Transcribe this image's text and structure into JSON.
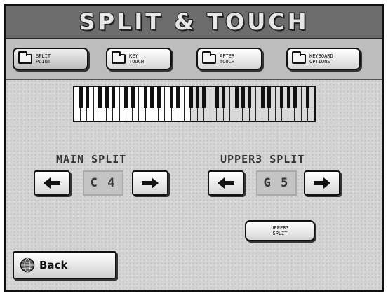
{
  "title": "SPLIT & TOUCH",
  "tabs": [
    {
      "label": "SPLIT\nPOINT",
      "icon": "folder-icon",
      "active": true
    },
    {
      "label": "KEY\nTOUCH",
      "icon": "folder-icon",
      "active": false
    },
    {
      "label": "AFTER\nTOUCH",
      "icon": "folder-icon",
      "active": false
    },
    {
      "label": "KEYBOARD\nOPTIONS",
      "icon": "folder-icon",
      "active": false
    }
  ],
  "main_split": {
    "label": "MAIN SPLIT",
    "value": "C 4",
    "left_icon": "arrow-left-icon",
    "right_icon": "arrow-right-icon"
  },
  "upper3_split": {
    "label": "UPPER3 SPLIT",
    "value": "G 5",
    "left_icon": "arrow-left-icon",
    "right_icon": "arrow-right-icon"
  },
  "upper3_split_button": {
    "label": "UPPER3\nSPLIT"
  },
  "back_button": {
    "label": "Back",
    "icon": "globe-icon"
  },
  "colors": {
    "title_bar": "#6c6c6c",
    "screen_bg": "#d4d4d4",
    "tab_row": "#bdbdbd",
    "upper_keys": "#d9d9d9"
  }
}
